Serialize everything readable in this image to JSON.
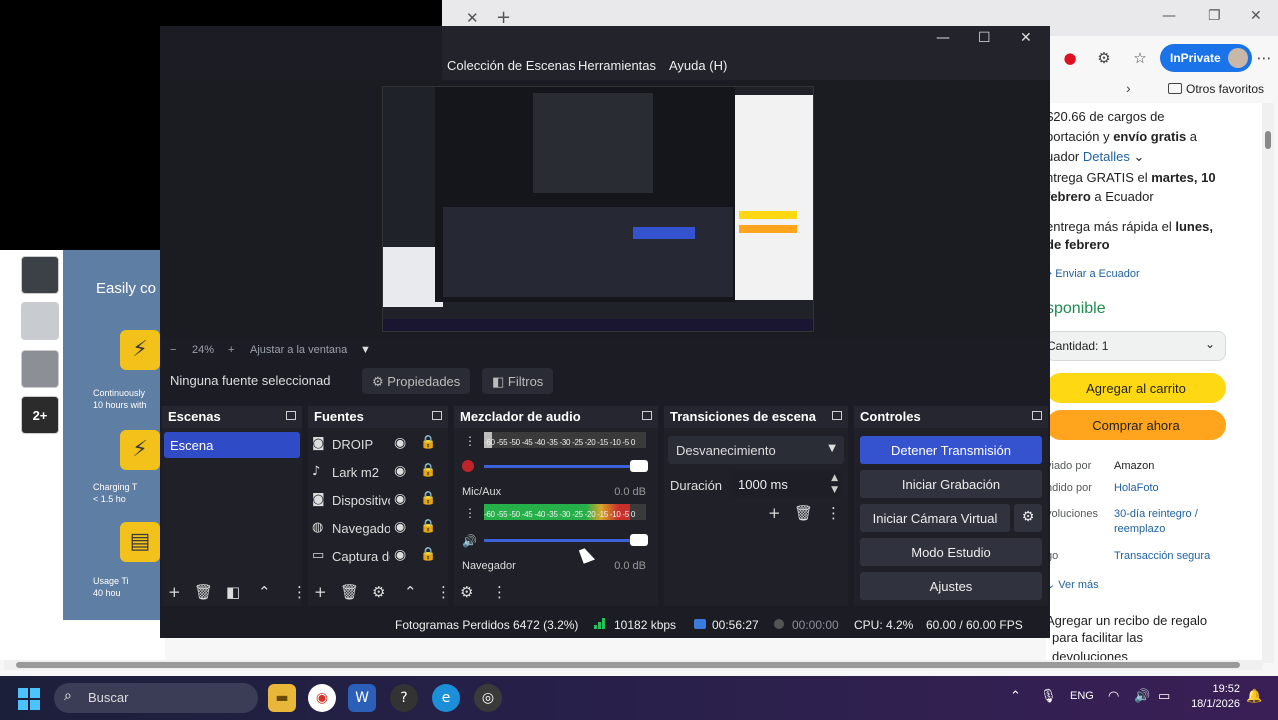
{
  "browser": {
    "inprivate_label": "InPrivate",
    "favorites_label": "Otros favoritos"
  },
  "amazon": {
    "shipping_line1": "$20.66 de cargos de",
    "shipping_line2_a": "portación y ",
    "shipping_line2_b": "envío gratis",
    "shipping_line2_c": " a",
    "shipping_line3_a": "uador ",
    "shipping_details_link": "Detalles",
    "delivery_line1_a": "ntrega GRATIS el ",
    "delivery_line1_b": "martes, 10",
    "delivery_line2_a": "febrero",
    "delivery_line2_b": " a Ecuador",
    "fast_line1_a": "entrega más rápida el ",
    "fast_line1_b": "lunes,",
    "fast_line2": "de febrero",
    "send_to": "Enviar a Ecuador",
    "availability": "sponible",
    "quantity_label": "Cantidad:",
    "quantity_value": "1",
    "add_to_cart": "Agregar al carrito",
    "buy_now": "Comprar ahora",
    "shipped_by_label": "viado por",
    "shipped_by_value": "Amazon",
    "sold_by_label": "ndido por",
    "sold_by_value": "HolaFoto",
    "returns_label": "voluciones",
    "returns_value_1": "30-día reintegro /",
    "returns_value_2": "reemplazo",
    "payment_label": "go",
    "payment_value": "Transacción segura",
    "see_more": "Ver más",
    "gift_line1": "Agregar un recibo de regalo",
    "gift_line2": "para facilitar las",
    "gift_line3": "devoluciones"
  },
  "product": {
    "headline": "Easily co",
    "feature1_caption_1": "Continuously",
    "feature1_caption_2": "10 hours with",
    "feature2_caption_1": "Charging T",
    "feature2_caption_2": "< 1.5 ho",
    "feature3_caption_1": "Usage Ti",
    "feature3_caption_2": "40 hou",
    "more_thumbs": "2+"
  },
  "obs": {
    "menu": [
      "Colección de Escenas",
      "Herramientas",
      "Ayuda (H)"
    ],
    "zoom": "24%",
    "fit_label": "Ajustar a la ventana",
    "no_source": "Ninguna fuente seleccionad",
    "properties": "Propiedades",
    "filters": "Filtros",
    "docks": {
      "scenes": "Escenas",
      "sources": "Fuentes",
      "mixer": "Mezclador de audio",
      "transitions": "Transiciones de escena",
      "controls": "Controles"
    },
    "scenes": [
      "Escena"
    ],
    "sources": [
      {
        "name": "DROIP",
        "icon": "camera-icon"
      },
      {
        "name": "Lark m2",
        "icon": "microphone-icon"
      },
      {
        "name": "Dispositivo",
        "icon": "camera-icon"
      },
      {
        "name": "Navegador",
        "icon": "globe-icon"
      },
      {
        "name": "Captura de",
        "icon": "monitor-icon"
      }
    ],
    "mixer": {
      "meter_scale": "-60 -55 -50 -45 -40 -35 -30 -25 -20 -15 -10 -5 0",
      "channel2_name": "Mic/Aux",
      "channel2_db": "0.0 dB",
      "channel3_name": "Navegador",
      "channel3_db": "0.0 dB",
      "channel1_level": 0.05,
      "channel2_level": 0.9
    },
    "transition": {
      "type": "Desvanecimiento",
      "duration_label": "Duración",
      "duration_value": "1000 ms"
    },
    "controls": {
      "stop_stream": "Detener Transmisión",
      "start_recording": "Iniciar Grabación",
      "start_virtual_cam": "Iniciar Cámara Virtual",
      "studio_mode": "Modo Estudio",
      "settings": "Ajustes"
    },
    "status": {
      "dropped_frames": "Fotogramas Perdidos 6472 (3.2%)",
      "bitrate": "10182 kbps",
      "stream_time": "00:56:27",
      "rec_time": "00:00:00",
      "cpu": "CPU: 4.2%",
      "fps": "60.00 / 60.00 FPS"
    }
  },
  "taskbar": {
    "search_placeholder": "Buscar",
    "lang": "ENG",
    "time": "19:52",
    "date": "18/1/2026"
  }
}
